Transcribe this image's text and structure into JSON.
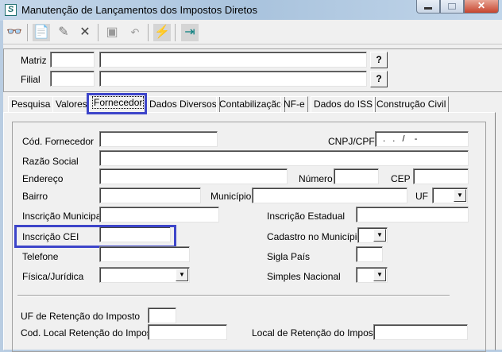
{
  "window": {
    "title": "Manutenção de Lançamentos dos Impostos Diretos",
    "app_icon": "S"
  },
  "toolbar": {
    "icons": [
      "binoculars-icon",
      "new-document-icon",
      "edit-icon",
      "delete-icon",
      "save-icon",
      "undo-icon",
      "filter-icon",
      "exit-icon"
    ]
  },
  "header": {
    "matriz_label": "Matriz",
    "filial_label": "Filial",
    "lookup": "?"
  },
  "tabs": [
    "Pesquisa",
    "Valores",
    "Fornecedor",
    "Dados Diversos",
    "Contabilização",
    "NF-e",
    "Dados do ISS",
    "Construção Civil"
  ],
  "active_tab": "Fornecedor",
  "form": {
    "cod_fornecedor": "Cód. Fornecedor",
    "cnpj_cpf": "CNPJ/CPF",
    "cnpj_mask": " .   .   /    -",
    "razao_social": "Razão Social",
    "endereco": "Endereço",
    "numero": "Número",
    "cep": "CEP",
    "bairro": "Bairro",
    "municipio": "Município",
    "uf": "UF",
    "inscricao_municipal": "Inscrição Municipal",
    "inscricao_estadual": "Inscrição Estadual",
    "inscricao_cei": "Inscrição CEI",
    "cadastro_municipio": "Cadastro no Município",
    "telefone": "Telefone",
    "sigla_pais": "Sigla País",
    "fisica_juridica": "Física/Jurídica",
    "simples_nacional": "Simples Nacional",
    "uf_retencao": "UF de Retenção do Imposto",
    "cod_local_retencao": "Cod. Local Retenção do Imposto",
    "local_retencao": "Local de Retenção do Imposto"
  },
  "highlight_color": "#3d45c9"
}
